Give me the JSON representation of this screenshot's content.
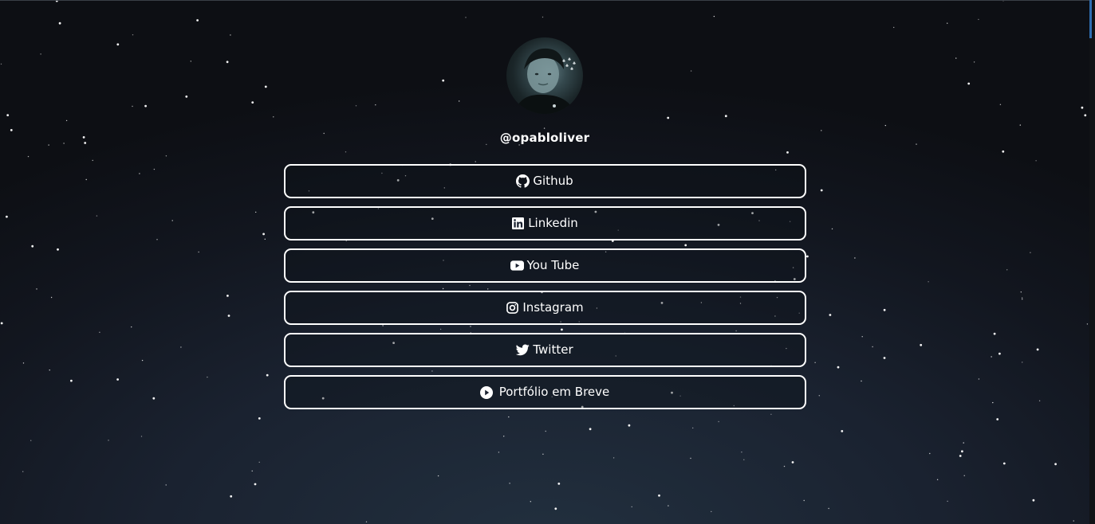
{
  "profile": {
    "username": "@opabloliver",
    "avatar_icon": "profile-photo"
  },
  "links": [
    {
      "label": "Github",
      "icon": "github-icon"
    },
    {
      "label": "Linkedin",
      "icon": "linkedin-icon"
    },
    {
      "label": "You Tube",
      "icon": "youtube-icon"
    },
    {
      "label": "Instagram",
      "icon": "instagram-icon"
    },
    {
      "label": "Twitter",
      "icon": "twitter-icon"
    },
    {
      "label": "Portfólio em Breve",
      "icon": "play-circle-icon"
    }
  ],
  "colors": {
    "background_center": "#22303f",
    "background_edge": "#0d0f14",
    "button_border": "#ffffff",
    "text": "#ffffff",
    "scrollbar_thumb": "#2f6fb3"
  }
}
